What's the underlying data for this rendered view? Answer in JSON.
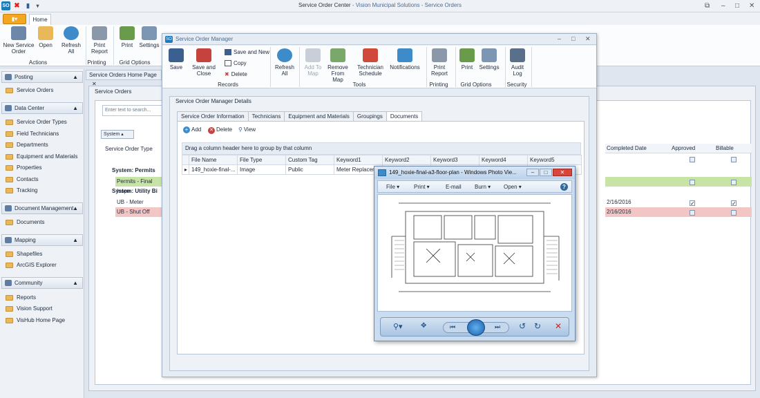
{
  "app": {
    "title": "Service Order Center",
    "subtitle": " - Vision Municipal Solutions - Service Orders",
    "logo": "SO",
    "file_tab": "",
    "home_tab": "Home"
  },
  "ribbon": {
    "buttons": [
      "New Service Order",
      "Open",
      "Refresh All",
      "Print Report",
      "Print",
      "Settings"
    ],
    "groups": [
      "Actions",
      "Printing",
      "Grid Options"
    ]
  },
  "sidebar": {
    "sections": [
      {
        "title": "Posting",
        "items": [
          "Service Orders"
        ]
      },
      {
        "title": "Data Center",
        "items": [
          "Service Order Types",
          "Field Technicians",
          "Departments",
          "Equipment and Materials",
          "Properties",
          "Contacts",
          "Tracking"
        ]
      },
      {
        "title": "Document Management",
        "items": [
          "Documents"
        ]
      },
      {
        "title": "Mapping",
        "items": [
          "Shapefiles",
          "ArcGIS Explorer"
        ]
      },
      {
        "title": "Community",
        "items": [
          "Reports",
          "Vision Support",
          "VisHub Home Page"
        ]
      }
    ]
  },
  "main": {
    "doc_tab": "Service Orders Home Page",
    "panel_title": "Service Orders",
    "search_placeholder": "Enter text to search...",
    "group_chip": "System",
    "col_type": "Service Order Type",
    "col_completed": "Completed Date",
    "col_approved": "Approved",
    "col_billable": "Billable",
    "group_permits": "System: Permits",
    "row_permits": "Permits - Final Inspe",
    "group_utility": "System: Utility Bi",
    "row_meter": "UB - Meter Replacem",
    "row_shutoff": "UB - Shut Off",
    "date_meter": "2/16/2016",
    "date_shutoff": "2/16/2016"
  },
  "manager": {
    "title": "Service Order Manager",
    "buttons": {
      "save": "Save",
      "save_close": "Save and Close",
      "save_new": "Save and New",
      "copy": "Copy",
      "delete": "Delete",
      "refresh_all": "Refresh All",
      "add_to_map": "Add To Map",
      "remove_from_map": "Remove From Map",
      "technician_schedule": "Technician Schedule",
      "notifications": "Notifications",
      "print_report": "Print Report",
      "print": "Print",
      "settings": "Settings",
      "audit_log": "Audit Log"
    },
    "groups": {
      "records": "Records",
      "tools": "Tools",
      "printing": "Printing",
      "grid_options": "Grid Options",
      "security": "Security"
    },
    "details_title": "Service Order Manager Details",
    "tabs": [
      "Service Order Information",
      "Technicians",
      "Equipment and Materials",
      "Groupings",
      "Documents"
    ],
    "doc_toolbar": {
      "add": "Add",
      "delete": "Delete",
      "view": "View"
    },
    "group_hint": "Drag a column header here to group by that column",
    "columns": [
      "File Name",
      "File Type",
      "Custom Tag",
      "Keyword1",
      "Keyword2",
      "Keyword3",
      "Keyword4",
      "Keyword5"
    ],
    "row": {
      "file_name": "149_hoxie-final-...",
      "file_type": "Image",
      "custom_tag": "Public",
      "keyword1": "Meter Replacement"
    }
  },
  "photo_viewer": {
    "title": "149_hoxie-final-a3-floor-plan - Windows Photo Vie...",
    "menu": [
      "File",
      "Print",
      "E-mail",
      "Burn",
      "Open"
    ],
    "help": "?"
  }
}
